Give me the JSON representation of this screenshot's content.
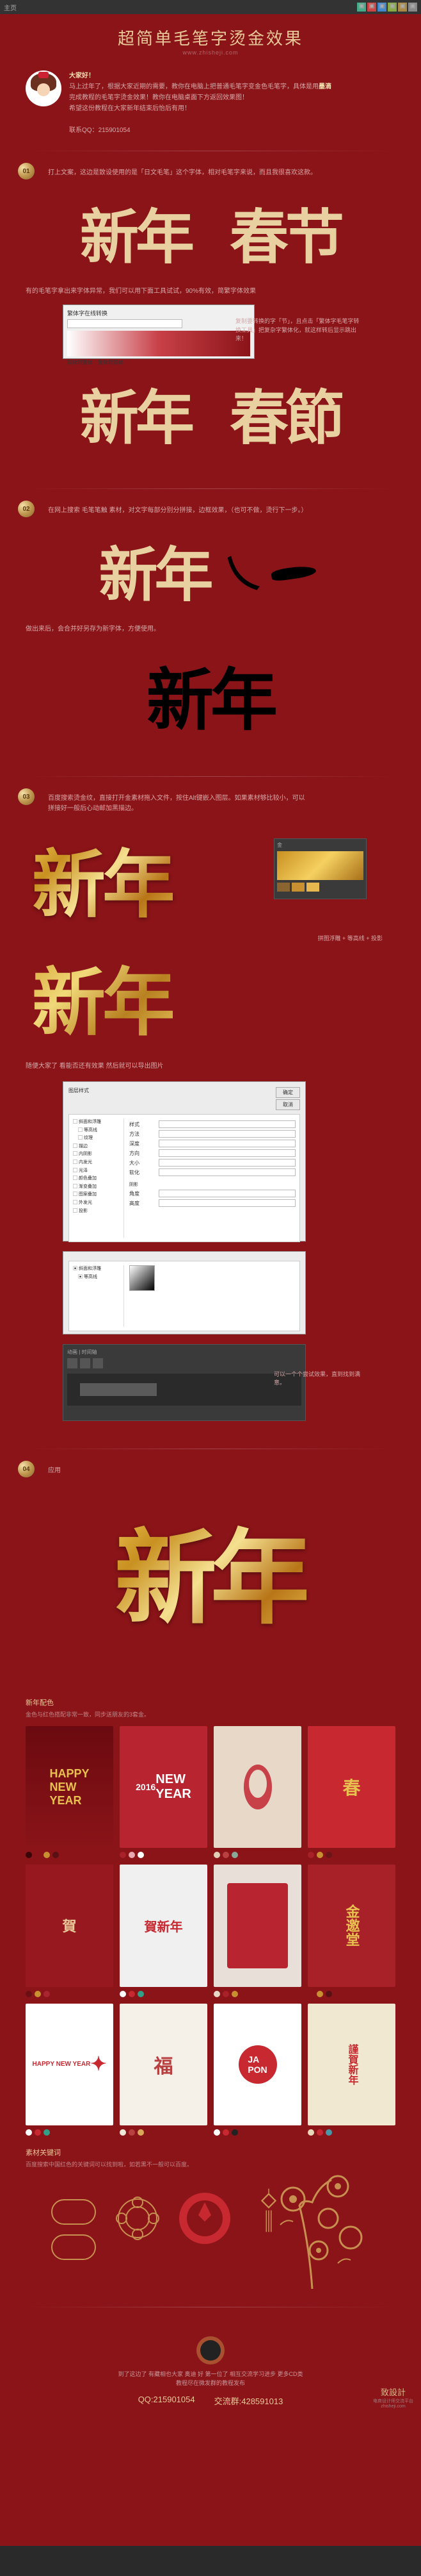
{
  "topbar": {
    "left": "主页"
  },
  "header": {
    "title": "超简单毛笔字烫金效果",
    "subtitle": "www.zhisheji.com"
  },
  "intro": {
    "greeting": "大家好！",
    "line1": "马上过年了，根据大家近期的需要，教你在电脑上把普通毛笔字变金色毛笔字，具体是用",
    "hl1": "墨滴",
    "line2": "完成教程的毛笔字烫金效果！教你在电脑桌面下方返回效果图！",
    "line3": "希望这份教程在大家新年结束后怡后有用！",
    "qq_label": "联系QQ：",
    "qq": "215901054"
  },
  "steps": {
    "s1": {
      "num": "01",
      "text1": "打上文案，这边是致设使用的是「日文毛笔」这个字体，相对毛笔字来说，而且我很喜欢这款。",
      "brush1": "新年",
      "brush2": "春节",
      "text2": "有的毛笔字拿出来字体异常，我们可以用下面工具试试，90%有效，简繁字体效果",
      "note": "复制要转换的字「节」，且点击「繁体字毛笔字转换工具」把复杂字繁体化，就这样转后显示跳出来！",
      "brush3": "新年",
      "brush4": "春節"
    },
    "s2": {
      "num": "02",
      "text1": "在网上搜索 毛笔笔触 素材，对文字每部分别分拼接，边框效果，（也可不做，烫行下一步。）",
      "brush1": "新年",
      "brush2": "新年",
      "text2": "做出来后，会合并好另存为新字体，方便使用。"
    },
    "s3": {
      "num": "03",
      "text1": "百度搜索烫金纹，直接打开金素材拖入文件，按住Alt键嵌入图层。如果素材够比较小，可以",
      "text2": "拼接好一般后心动邮加黑描边。",
      "brush1": "新年",
      "brush2": "新年",
      "label1": "拼图浮雕 + 等高线 + 投影",
      "text3": "随便大家了  看能否还有效果    然后就可以导出图片",
      "note2": "可以一个个尝试效果，直到找到满意。"
    },
    "s4": {
      "num": "04",
      "title": "应用",
      "brush": "新年"
    }
  },
  "showcase": {
    "title": "新年配色",
    "sub": "金色与红色搭配非常一致，同步送朋友的3套金。"
  },
  "assets": {
    "title": "素材关键词",
    "sub": "百度搜索中国红色的关键词可以找到啦，如若黑不一般可以百度。"
  },
  "footer": {
    "line1": "到了这边了 有藏相也大家 奥迪 好 第一位了 相互交流学习进步  更多CD类",
    "line2": "教程尽在微发群的教程发布",
    "qq1_label": "QQ:",
    "qq1": "215901054",
    "qq2_label": "交流群:",
    "qq2": "428591013",
    "logo": "致設計",
    "logo_sub": "电商设计师交流平台\nzhisheji.com"
  }
}
